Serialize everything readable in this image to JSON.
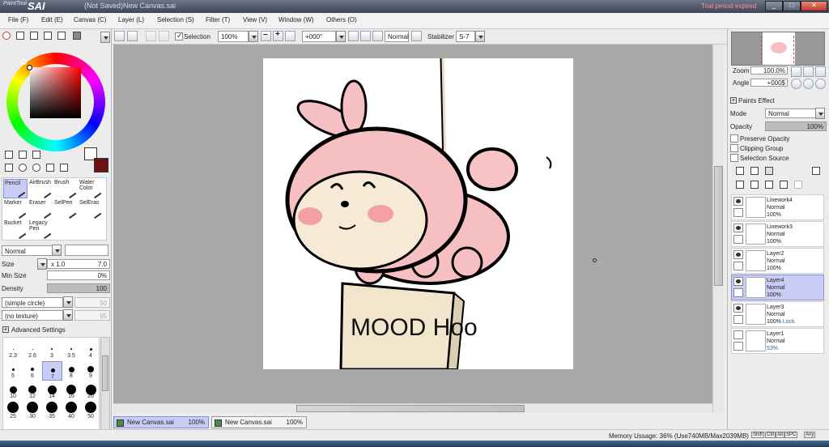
{
  "app": {
    "title": "(Not Saved)New Canvas.sai",
    "product": "SAI",
    "trial": "Trial period expired",
    "window_buttons": [
      "_",
      "□",
      "✕"
    ]
  },
  "menu": [
    "File (F)",
    "Edit (E)",
    "Canvas (C)",
    "Layer (L)",
    "Selection (S)",
    "Filter (T)",
    "View (V)",
    "Window (W)",
    "Others (O)"
  ],
  "toolbar": {
    "selection_label": "Selection",
    "zoom": "100%",
    "rotation": "+000°",
    "mode": "Normal",
    "stabilizer_label": "Stabilizer",
    "stabilizer_value": "S-7"
  },
  "tools": [
    {
      "label": "Pencil",
      "selected": true
    },
    {
      "label": "AirBrush",
      "selected": false
    },
    {
      "label": "Brush",
      "selected": false
    },
    {
      "label": "Water Color",
      "selected": false
    },
    {
      "label": "Marker",
      "selected": false
    },
    {
      "label": "Eraser",
      "selected": false
    },
    {
      "label": "SelPen",
      "selected": false
    },
    {
      "label": "SelEras",
      "selected": false
    },
    {
      "label": "Bucket",
      "selected": false
    },
    {
      "label": "Legacy Pen",
      "selected": false
    }
  ],
  "brush": {
    "blend": "Normal",
    "size_label": "Size",
    "size_mult": "x 1.0",
    "size_value": "7.0",
    "minsize_label": "Min Size",
    "minsize_value": "0%",
    "density_label": "Density",
    "density_value": "100",
    "shape": "(simple circle)",
    "shape_value": "50",
    "texture": "(no texture)",
    "texture_value": "95",
    "advanced": "Advanced Settings"
  },
  "brush_sizes": [
    "2.3",
    "2.6",
    "3",
    "3.5",
    "4",
    "5",
    "6",
    "7",
    "8",
    "9",
    "10",
    "12",
    "14",
    "16",
    "20",
    "25",
    "30",
    "35",
    "40",
    "50"
  ],
  "selected_brush_size": "7",
  "canvas_text": "MOOD Hoo",
  "navigator": {
    "zoom_label": "Zoom",
    "zoom_value": "100.0%",
    "angle_label": "Angle",
    "angle_value": "+000$"
  },
  "paints_effect": {
    "header": "Paints Effect",
    "mode_label": "Mode",
    "mode_value": "Normal",
    "opacity_label": "Opacity",
    "opacity_value": "100%",
    "opacity_level": 1.0,
    "preserve_opacity": "Preserve Opacity",
    "clipping_group": "Clipping Group",
    "selection_source": "Selection Source"
  },
  "layers": [
    {
      "name": "Linework4",
      "mode": "Normal",
      "opacity": "100%",
      "extra": "",
      "visible": true,
      "selected": false
    },
    {
      "name": "Linework3",
      "mode": "Normal",
      "opacity": "100%",
      "extra": "",
      "visible": true,
      "selected": false
    },
    {
      "name": "Layer2",
      "mode": "Normal",
      "opacity": "100%",
      "extra": "",
      "visible": true,
      "selected": false
    },
    {
      "name": "Layer4",
      "mode": "Normal",
      "opacity": "100%",
      "extra": "",
      "visible": true,
      "selected": true
    },
    {
      "name": "Layer3",
      "mode": "Normal",
      "opacity": "100%",
      "extra": "Lock",
      "visible": true,
      "selected": false
    },
    {
      "name": "Layer1",
      "mode": "Normal",
      "opacity": "53%",
      "extra": "",
      "visible": false,
      "selected": false
    }
  ],
  "documents": [
    {
      "name": "New Canvas.sai",
      "zoom": "100%"
    },
    {
      "name": "New Canvas.sai",
      "zoom": "100%"
    }
  ],
  "status": {
    "memory": "Memory Ussage: 36% (Use740MB/Max2039MB)",
    "keys": [
      "Shift",
      "Ctrl",
      "Alt",
      "SPC",
      "Any"
    ]
  },
  "colors": {
    "primary": "#ffffff",
    "secondary": "#6b1212",
    "selection_highlight": "#c9cdf5",
    "trial": "#ff8fa0"
  }
}
